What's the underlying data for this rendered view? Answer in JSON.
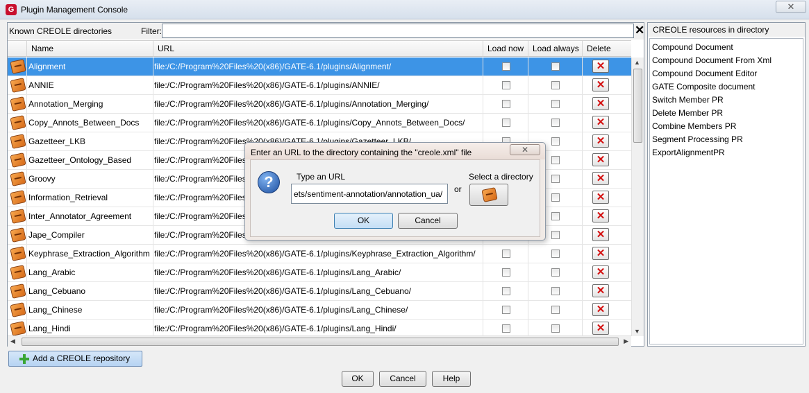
{
  "window": {
    "title": "Plugin Management Console",
    "app_icon": "G",
    "close_glyph": "✕"
  },
  "left_panel": {
    "known_label": "Known CREOLE directories",
    "filter_label": "Filter:",
    "filter_value": "",
    "clear_glyph": "✕",
    "columns": {
      "name": "Name",
      "url": "URL",
      "load_now": "Load now",
      "load_always": "Load always",
      "delete": "Delete"
    },
    "rows": [
      {
        "name": "Alignment",
        "url": "file:/C:/Program%20Files%20(x86)/GATE-6.1/plugins/Alignment/",
        "selected": true
      },
      {
        "name": "ANNIE",
        "url": "file:/C:/Program%20Files%20(x86)/GATE-6.1/plugins/ANNIE/",
        "selected": false
      },
      {
        "name": "Annotation_Merging",
        "url": "file:/C:/Program%20Files%20(x86)/GATE-6.1/plugins/Annotation_Merging/",
        "selected": false
      },
      {
        "name": "Copy_Annots_Between_Docs",
        "url": "file:/C:/Program%20Files%20(x86)/GATE-6.1/plugins/Copy_Annots_Between_Docs/",
        "selected": false
      },
      {
        "name": "Gazetteer_LKB",
        "url": "file:/C:/Program%20Files%20(x86)/GATE-6.1/plugins/Gazetteer_LKB/",
        "selected": false
      },
      {
        "name": "Gazetteer_Ontology_Based",
        "url": "file:/C:/Program%20Files%20(x86)/GATE-6.1/plugins/Gazetteer_Ontology_Based/",
        "selected": false
      },
      {
        "name": "Groovy",
        "url": "file:/C:/Program%20Files%20(x86)/GATE-6.1/plugins/Groovy/",
        "selected": false
      },
      {
        "name": "Information_Retrieval",
        "url": "file:/C:/Program%20Files%20(x86)/GATE-6.1/plugins/Information_Retrieval/",
        "selected": false
      },
      {
        "name": "Inter_Annotator_Agreement",
        "url": "file:/C:/Program%20Files%20(x86)/GATE-6.1/plugins/Inter_Annotator_Agreement/",
        "selected": false
      },
      {
        "name": "Jape_Compiler",
        "url": "file:/C:/Program%20Files%20(x86)/GATE-6.1/plugins/Jape_Compiler/",
        "selected": false
      },
      {
        "name": "Keyphrase_Extraction_Algorithm",
        "url": "file:/C:/Program%20Files%20(x86)/GATE-6.1/plugins/Keyphrase_Extraction_Algorithm/",
        "selected": false
      },
      {
        "name": "Lang_Arabic",
        "url": "file:/C:/Program%20Files%20(x86)/GATE-6.1/plugins/Lang_Arabic/",
        "selected": false
      },
      {
        "name": "Lang_Cebuano",
        "url": "file:/C:/Program%20Files%20(x86)/GATE-6.1/plugins/Lang_Cebuano/",
        "selected": false
      },
      {
        "name": "Lang_Chinese",
        "url": "file:/C:/Program%20Files%20(x86)/GATE-6.1/plugins/Lang_Chinese/",
        "selected": false
      },
      {
        "name": "Lang_Hindi",
        "url": "file:/C:/Program%20Files%20(x86)/GATE-6.1/plugins/Lang_Hindi/",
        "selected": false
      }
    ],
    "delete_glyph": "✕"
  },
  "right_panel": {
    "header": "CREOLE resources in directory",
    "items": [
      "Compound Document",
      "Compound Document From Xml",
      "Compound Document Editor",
      "GATE Composite document",
      "Switch Member PR",
      "Delete Member PR",
      "Combine Members PR",
      "Segment Processing PR",
      "ExportAlignmentPR"
    ]
  },
  "bottom": {
    "add_repo_label": "Add a CREOLE repository",
    "ok_label": "OK",
    "cancel_label": "Cancel",
    "help_label": "Help"
  },
  "dialog": {
    "title": "Enter an URL to the directory containing the \"creole.xml\" file",
    "close_glyph": "✕",
    "question_glyph": "?",
    "type_url_label": "Type an URL",
    "url_value": "ets/sentiment-annotation/annotation_ua/",
    "or_label": "or",
    "select_dir_label": "Select a directory",
    "ok_label": "OK",
    "cancel_label": "Cancel"
  },
  "colors": {
    "selection": "#3d94e6",
    "delete_red": "#d41010",
    "plus_green": "#3aa634"
  }
}
